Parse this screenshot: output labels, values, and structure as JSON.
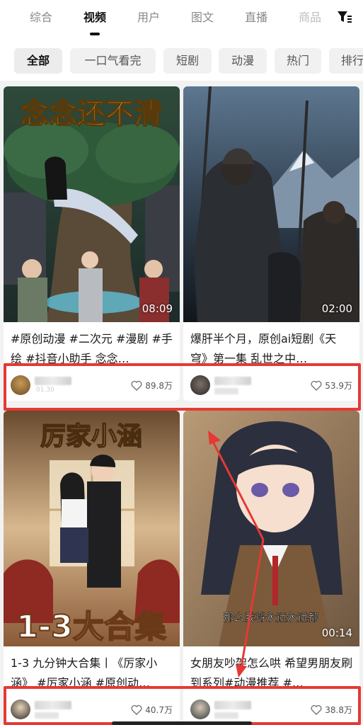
{
  "tabs": [
    {
      "label": "综合",
      "active": false
    },
    {
      "label": "视频",
      "active": true
    },
    {
      "label": "用户",
      "active": false
    },
    {
      "label": "图文",
      "active": false
    },
    {
      "label": "直播",
      "active": false
    },
    {
      "label": "商品",
      "active": false
    }
  ],
  "filter_icon": "filter-icon",
  "chips": [
    {
      "label": "全部",
      "active": true
    },
    {
      "label": "一口气看完",
      "active": false
    },
    {
      "label": "短剧",
      "active": false
    },
    {
      "label": "动漫",
      "active": false
    },
    {
      "label": "热门",
      "active": false
    },
    {
      "label": "排行",
      "active": false
    }
  ],
  "videos": [
    {
      "thumb_text": "念念还不清",
      "duration": "08:09",
      "title": "#原创动漫 #二次元 #漫剧 #手绘 #抖音小助手 念念…",
      "likes": "89.8万",
      "sub": "01.30"
    },
    {
      "thumb_text": "",
      "duration": "02:00",
      "title": "爆肝半个月，原创ai短剧《天穹》第一集 乱世之中…",
      "likes": "53.9万",
      "sub": ""
    },
    {
      "thumb_text": "厉家小涵",
      "thumb_text2": "1-3大合集",
      "duration": "",
      "title": "1-3 九分钟大合集丨《厉家小涵》 #厉家小涵 #原创动…",
      "likes": "40.7万",
      "sub": ""
    },
    {
      "thumb_text": "",
      "subtitle": "那么我将永远永远都",
      "duration": "00:14",
      "title": "女朋友吵架怎么哄 希望男朋友刷到系列#动漫推荐 #…",
      "likes": "38.8万",
      "sub": ""
    }
  ],
  "colors": {
    "annotation": "#e53935",
    "background": "#f2f2f2"
  }
}
